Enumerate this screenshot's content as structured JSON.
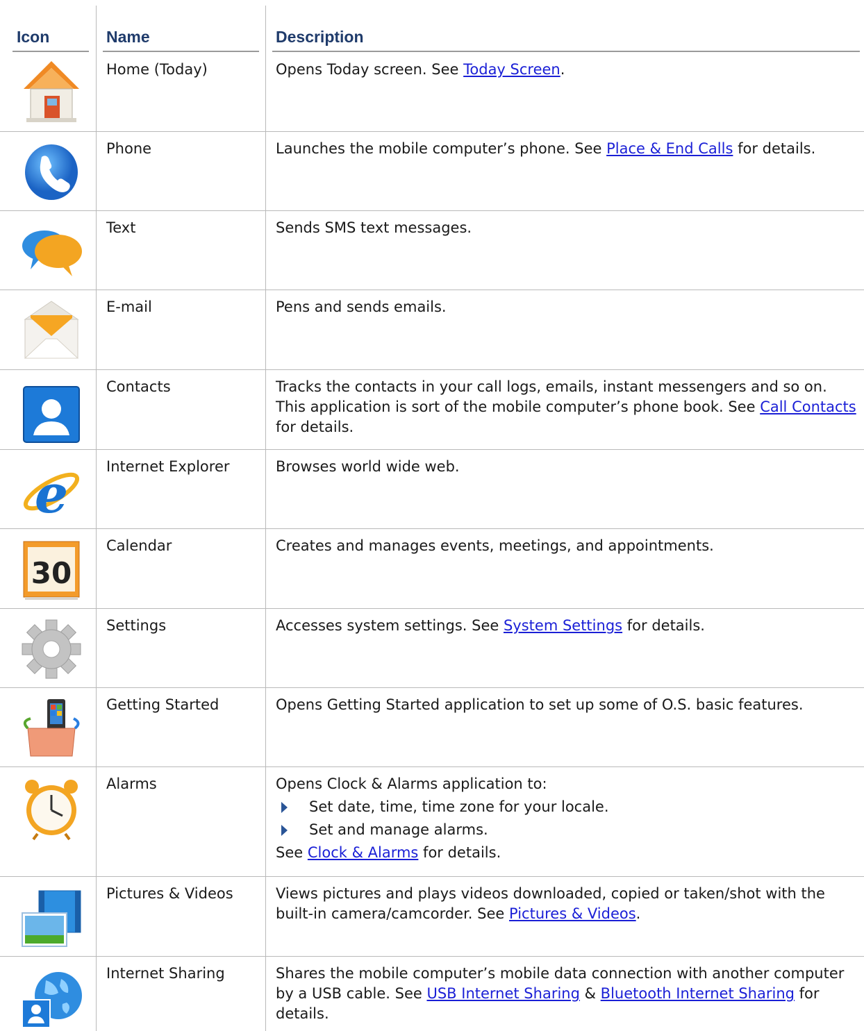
{
  "header": {
    "icon": "Icon",
    "name": "Name",
    "description": "Description"
  },
  "rows": [
    {
      "icon": "home-icon",
      "name": "Home (Today)",
      "pre": "Opens Today screen. See ",
      "link": "Today Screen",
      "post": "."
    },
    {
      "icon": "phone-icon",
      "name": "Phone",
      "pre": "Launches the mobile computer’s phone. See ",
      "link": "Place & End Calls",
      "post": " for details."
    },
    {
      "icon": "text-icon",
      "name": "Text",
      "pre": "Sends SMS text messages."
    },
    {
      "icon": "email-icon",
      "name": "E-mail",
      "pre": "Pens and sends emails."
    },
    {
      "icon": "contacts-icon",
      "name": "Contacts",
      "pre": "Tracks the contacts in your call logs, emails, instant messengers and so on. This application is sort of the mobile computer’s phone book. See ",
      "link": "Call Contacts",
      "post": " for details."
    },
    {
      "icon": "internet-explorer-icon",
      "name": "Internet Explorer",
      "pre": "Browses world wide web."
    },
    {
      "icon": "calendar-icon",
      "name": "Calendar",
      "pre": "Creates and manages events, meetings, and appointments.",
      "badge": "30"
    },
    {
      "icon": "settings-icon",
      "name": "Settings",
      "pre": "Accesses system settings. See ",
      "link": "System Settings",
      "post": " for details."
    },
    {
      "icon": "getting-started-icon",
      "name": "Getting Started",
      "pre": "Opens Getting Started application to set up some of O.S. basic features."
    },
    {
      "icon": "alarm-clock-icon",
      "name": "Alarms",
      "pre": "Opens Clock & Alarms application to:",
      "bullets": [
        "Set date, time, time zone for your locale.",
        "Set and manage alarms."
      ],
      "see_pre": "See ",
      "link": "Clock & Alarms",
      "post": " for details."
    },
    {
      "icon": "pictures-videos-icon",
      "name": "Pictures & Videos",
      "pre": "Views pictures and plays videos downloaded, copied or taken/shot with the built-in camera/camcorder. See ",
      "link": "Pictures & Videos",
      "post": "."
    },
    {
      "icon": "internet-sharing-icon",
      "name": "Internet Sharing",
      "pre": "Shares the mobile computer’s mobile data connection with another computer by a USB cable. See ",
      "link": "USB Internet Sharing",
      "mid": " & ",
      "link2": "Bluetooth Internet Sharing",
      "post": " for details."
    }
  ]
}
